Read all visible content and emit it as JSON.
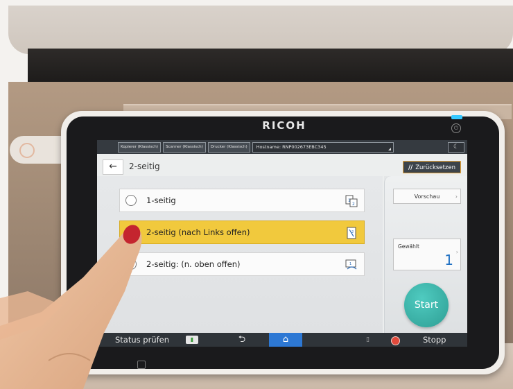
{
  "device": {
    "brand": "RICOH"
  },
  "topbar": {
    "tabs": [
      "Kopierer (Klassisch)",
      "Scanner (Klassisch)",
      "Drucker (Klassisch)"
    ],
    "hostname": "Hostname: RNP002673EBC345",
    "moon_icon": "moon-icon"
  },
  "header": {
    "back_symbol": "←",
    "title": "2-seitig",
    "reset_label": "Zurücksetzen"
  },
  "options": [
    {
      "label": "1-seitig",
      "selected": false
    },
    {
      "label": "2-seitig (nach Links offen)",
      "selected": true
    },
    {
      "label": "2-seitig: (n. oben offen)",
      "selected": false
    }
  ],
  "side_panel": {
    "preview_label": "Vorschau",
    "count_label": "Gewählt",
    "count_value": "1",
    "start_label": "Start"
  },
  "bottombar": {
    "status_label": "Status prüfen",
    "back_symbol": "⮌",
    "home_symbol": "⌂",
    "stop_label": "Stopp"
  },
  "colors": {
    "selected_option": "#f1c93d",
    "start_button": "#3ab5aa",
    "reset_border": "#e9a63a",
    "home_button": "#2d78d4",
    "count_value": "#1e6fc2"
  }
}
